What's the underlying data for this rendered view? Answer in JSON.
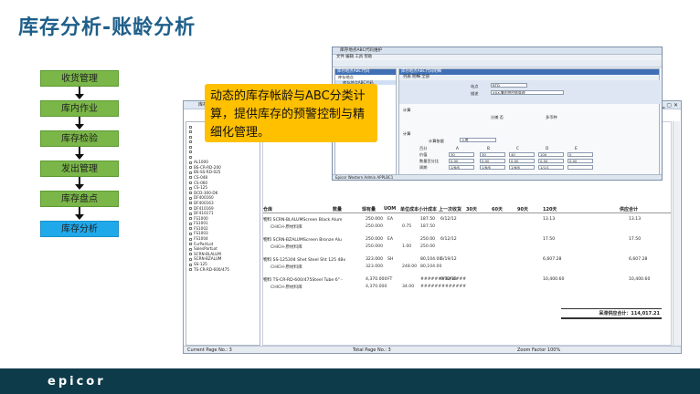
{
  "page": {
    "title": "库存分析-账龄分析",
    "callout": "动态的库存帐龄与ABC分类计算，提供库存的预警控制与精细化管理。",
    "brand": "epicor"
  },
  "flow": {
    "steps": [
      "收货管理",
      "库内作业",
      "库存检验",
      "发出管理",
      "库存盘点",
      "库存分析"
    ],
    "active_index": 5,
    "colors": {
      "step": "#7ab648",
      "active": "#1fa9ea"
    }
  },
  "report": {
    "title": "库存",
    "tree_items": [
      "",
      "",
      "",
      "",
      "",
      "",
      "",
      "AL1000",
      "BS-CR-RD-200",
      "BS-SS-RD-025",
      "CS-048",
      "CS-060",
      "CS-125",
      "DCD-300-DK",
      "DF400160",
      "DF400163",
      "DF410169",
      "DF410171",
      "FS1000",
      "FS1001",
      "FS1002",
      "FS1003",
      "FS1004",
      "FurPartLot",
      "SalesPartLot",
      "SCRN-BLALUM",
      "SCRN-BZALUM",
      "SS-125",
      "TS-CR-RD-600/475"
    ],
    "header_letters": "TS",
    "columns": [
      "仓库",
      "数量",
      "现有量",
      "UOM",
      "单位成本",
      "小计成本",
      "上一次收货",
      "30天",
      "60天",
      "90天",
      "120天",
      "供应合计"
    ],
    "rows": [
      {
        "part": "物料 SCRN-BLALUMScreen Black Alum",
        "qty": "250.000",
        "uom": "EA",
        "subtotal": "187.50",
        "date": "6/12/12",
        "d120": "13.13",
        "supply": "13.13"
      },
      {
        "part": "CHICH-原材料库",
        "qty": "250.000",
        "unit_cost": "0.75",
        "subtotal": "187.50"
      },
      {
        "part": "物料 SCRN-BZALUMScreen Bronze Alu",
        "qty": "250.000",
        "uom": "EA",
        "subtotal": "250.00",
        "date": "6/12/12",
        "d120": "17.50",
        "supply": "17.50"
      },
      {
        "part": "CHICH-原材料库",
        "qty": "250.000",
        "unit_cost": "1.00",
        "subtotal": "250.00"
      },
      {
        "part": "物料 SS-125304 Shet Steel Sht 125 48x",
        "qty": "323.000",
        "uom": "SH",
        "subtotal": "80,104.00",
        "date": "6/19/12",
        "d120": "6,607.28",
        "supply": "6,607.28"
      },
      {
        "part": "CHICH-原材料库",
        "qty": "323.000",
        "unit_cost": "248.00",
        "subtotal": "80,104.00"
      },
      {
        "part": "物料 TS-CR-RD-600/475Steel Tube 6\" -",
        "qty": "4,370.000",
        "uom": "FT",
        "subtotal": "#############",
        "date": "6/12/12",
        "d120": "10,400.60",
        "supply": "10,400.60"
      },
      {
        "part": "CHICH-原材料库",
        "qty": "4,370.000",
        "unit_cost": "34.00",
        "subtotal": "#############"
      }
    ],
    "total": "呆滞供应合计：114,017.21",
    "status": {
      "current_page": "Current Page No.: 3",
      "total_page": "Total Page No.: 3",
      "zoom": "Zoom Factor 100%"
    }
  },
  "abc": {
    "title": "库存地点ABC代码维护",
    "menu": "文件  编辑  工具  帮助",
    "left_header": "库存地点ABC代码",
    "left_items": [
      "库存地点",
      "库存地点ABC代码"
    ],
    "right_header": "库存地点ABC代码明细",
    "tabs": "列表  明细  全部",
    "field_site_label": "站点",
    "field_site_value": "BTD",
    "field_desc_label": "描述",
    "field_desc_value": "XXX-集团供应链管理",
    "section_label": "计算",
    "checkbox1": "分摊  否",
    "checkbox2": "多币种",
    "section2_label": "计算",
    "calc_label": "计算依据",
    "calc_value": "入库",
    "grid_row_labels": [
      "百分",
      "价值",
      "数量百分比",
      "周期"
    ],
    "grid_cols": [
      "A",
      "B",
      "C",
      "D",
      "E"
    ],
    "grid_values": [
      [
        "30",
        "30",
        "40",
        "100",
        "0"
      ],
      [
        "0.00",
        "0.00",
        "0.00",
        "0.00",
        "0.00"
      ],
      [
        "1/6/6",
        "1/6/6",
        "1/6/6",
        "1/1/1",
        ""
      ]
    ],
    "status": "Epicor Western Admin  APPLBC1"
  }
}
